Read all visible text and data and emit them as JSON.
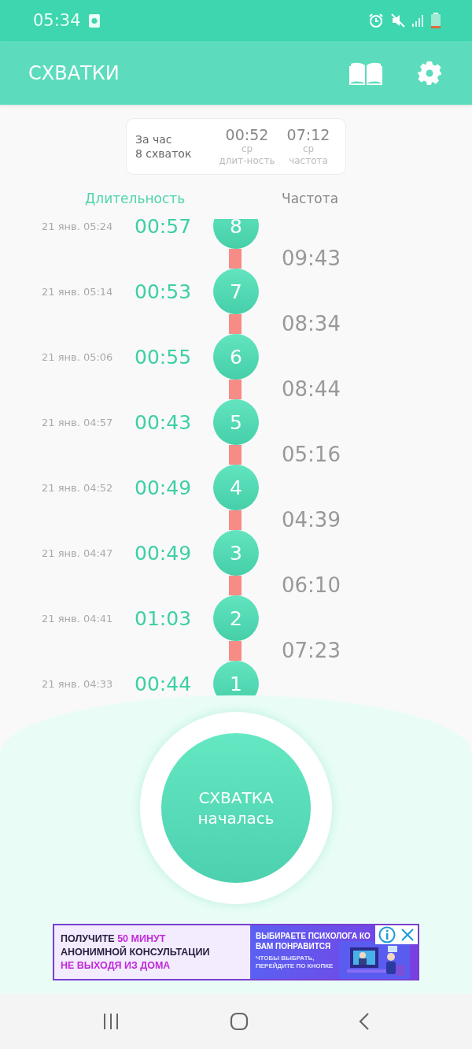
{
  "status_bar": {
    "time": "05:34"
  },
  "app_bar": {
    "title": "СХВАТКИ"
  },
  "summary": {
    "period": "За час",
    "count": "8 схваток",
    "stats": [
      {
        "value": "00:52",
        "caption_1": "ср",
        "caption_2": "длит-ность"
      },
      {
        "value": "07:12",
        "caption_1": "ср",
        "caption_2": "частота"
      }
    ]
  },
  "columns": [
    {
      "label": "Длительность",
      "kind": "duration"
    },
    {
      "label": "Частота",
      "kind": "frequency"
    }
  ],
  "contractions": [
    {
      "number": "8",
      "date": "21 янв. 05:24",
      "duration": "00:57",
      "interval": "09:43"
    },
    {
      "number": "7",
      "date": "21 янв. 05:14",
      "duration": "00:53",
      "interval": "08:34"
    },
    {
      "number": "6",
      "date": "21 янв. 05:06",
      "duration": "00:55",
      "interval": "08:44"
    },
    {
      "number": "5",
      "date": "21 янв. 04:57",
      "duration": "00:43",
      "interval": "05:16"
    },
    {
      "number": "4",
      "date": "21 янв. 04:52",
      "duration": "00:49",
      "interval": "04:39"
    },
    {
      "number": "3",
      "date": "21 янв. 04:47",
      "duration": "00:49",
      "interval": "06:10"
    },
    {
      "number": "2",
      "date": "21 янв. 04:41",
      "duration": "01:03",
      "interval": "07:23"
    },
    {
      "number": "1",
      "date": "21 янв. 04:33",
      "duration": "00:44"
    }
  ],
  "start_button": {
    "line_1": "СХВАТКА",
    "line_2": "началась"
  },
  "ad": {
    "headline": [
      {
        "parts": [
          {
            "text": "ПОЛУЧИТЕ",
            "color": "#2a2040"
          },
          {
            "text": "50 МИНУТ",
            "color": "#c02ad8"
          }
        ]
      },
      {
        "parts": [
          {
            "text": "АНОНИМНОЙ КОНСУЛЬТАЦИИ",
            "color": "#2a2040"
          }
        ]
      },
      {
        "parts": [
          {
            "text": "НЕ ВЫХОДЯ ИЗ ДОМА",
            "color": "#c02ad8"
          }
        ]
      }
    ],
    "title": "ВЫБИРАЕТЕ ПСИХОЛОГА КО",
    "title_2": "ВАМ ПОНРАВИТСЯ",
    "note_1": "ЧТОБЫ ВЫБРАТЬ,",
    "note_2": "ПЕРЕЙДИТЕ ПО КНОПКЕ"
  }
}
